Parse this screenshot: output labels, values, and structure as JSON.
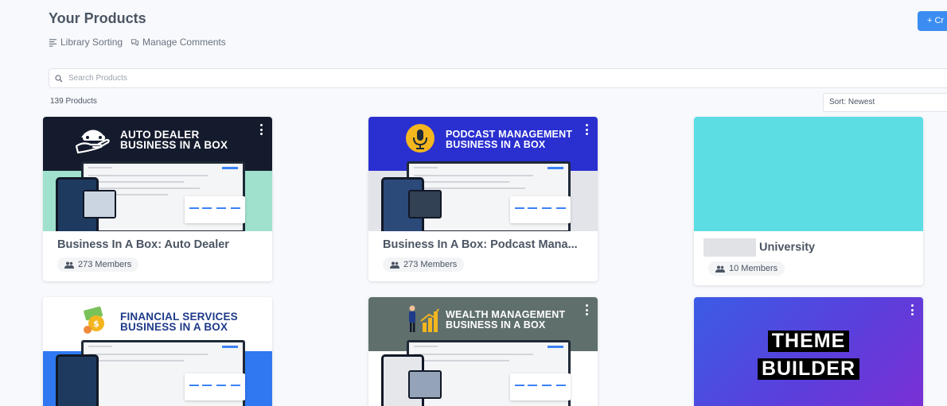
{
  "header": {
    "title": "Your Products",
    "create_label": "+ Cr",
    "links": [
      {
        "label": "Library Sorting",
        "icon": "sort-lines-icon"
      },
      {
        "label": "Manage Comments",
        "icon": "comments-icon"
      }
    ]
  },
  "search": {
    "placeholder": "Search Products",
    "icon": "search-icon"
  },
  "toolbar": {
    "count_label": "139 Products",
    "sort_label": "Sort: Newest"
  },
  "colors": {
    "accent": "#3b8df1",
    "teal_card": "#5cdde4"
  },
  "products": [
    {
      "name": "Business In A Box: Auto Dealer",
      "members": "273 Members",
      "thumb": {
        "line1": "AUTO DEALER",
        "line2": "BUSINESS IN A BOX",
        "head_color": "#141b2d",
        "foot_color": "#9fe1cd",
        "logo": "car-hand-icon"
      }
    },
    {
      "name": "Business In A Box: Podcast Mana...",
      "members": "273 Members",
      "thumb": {
        "line1": "PODCAST MANAGEMENT",
        "line2": "BUSINESS IN A BOX",
        "head_color": "#2a2fd0",
        "foot_color": "#e2e4e9",
        "logo": "microphone-icon"
      }
    },
    {
      "name": "University",
      "members": "10 Members",
      "thumb": {
        "head_color": "#5cdde4"
      }
    },
    {
      "name": "",
      "members": "",
      "thumb": {
        "line1": "FINANCIAL SERVICES",
        "line2": "BUSINESS IN A BOX",
        "head_color": "#ffffff",
        "foot_color": "#2f78f2",
        "logo": "money-icon"
      }
    },
    {
      "name": "",
      "members": "",
      "thumb": {
        "line1": "WEALTH MANAGEMENT",
        "line2": "BUSINESS IN A BOX",
        "head_color": "#5f6f6c",
        "foot_color": "#ffffff",
        "logo": "growth-chart-icon"
      }
    },
    {
      "name": "",
      "members": "",
      "thumb": {
        "line1": "THEME",
        "line2": "BUILDER",
        "gradient_from": "#3b5ce6",
        "gradient_to": "#7b2fd4"
      }
    }
  ]
}
